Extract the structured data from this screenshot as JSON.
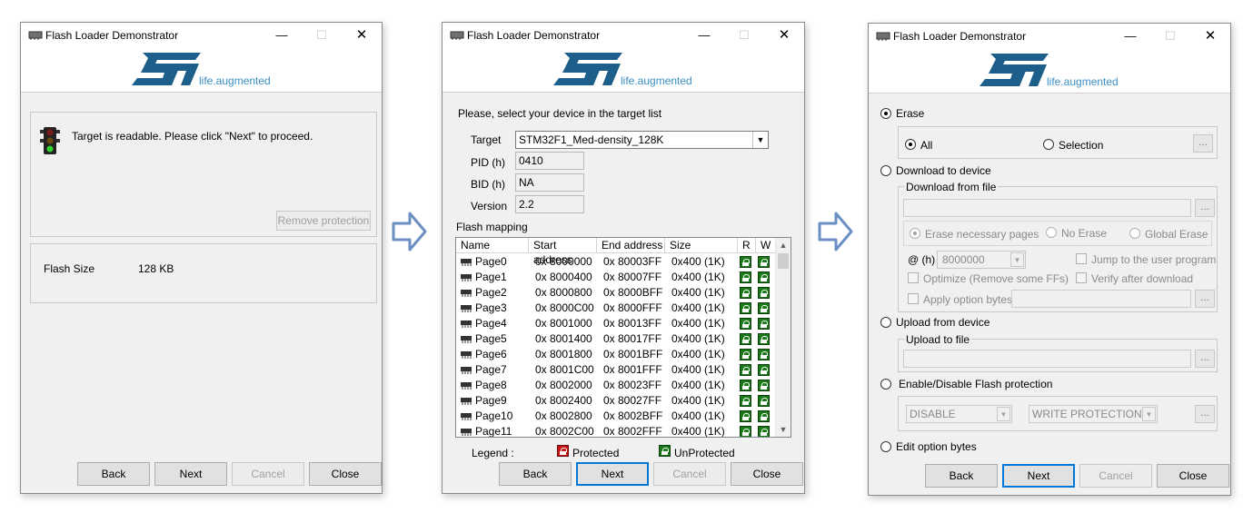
{
  "window_title": "Flash Loader Demonstrator",
  "logo": {
    "brand": "ST",
    "tagline": "life.augmented"
  },
  "buttons": {
    "back": "Back",
    "next": "Next",
    "cancel": "Cancel",
    "close": "Close"
  },
  "arrow_color": "#6b8fc2",
  "w1": {
    "message": "Target is readable. Please click \"Next\" to proceed.",
    "remove_protection": "Remove protection",
    "flash_size_label": "Flash Size",
    "flash_size_value": "128 KB"
  },
  "w2": {
    "prompt": "Please, select your device in the target list",
    "target_label": "Target",
    "target_value": "STM32F1_Med-density_128K",
    "pid_label": "PID  (h)",
    "pid_value": "0410",
    "bid_label": "BID  (h)",
    "bid_value": "NA",
    "version_label": "Version",
    "version_value": "2.2",
    "flash_mapping": "Flash mapping",
    "columns": [
      "Name",
      "Start address",
      "End address",
      "Size",
      "R",
      "W"
    ],
    "rows": [
      [
        "Page0",
        "0x 8000000",
        "0x 80003FF",
        "0x400 (1K)"
      ],
      [
        "Page1",
        "0x 8000400",
        "0x 80007FF",
        "0x400 (1K)"
      ],
      [
        "Page2",
        "0x 8000800",
        "0x 8000BFF",
        "0x400 (1K)"
      ],
      [
        "Page3",
        "0x 8000C00",
        "0x 8000FFF",
        "0x400 (1K)"
      ],
      [
        "Page4",
        "0x 8001000",
        "0x 80013FF",
        "0x400 (1K)"
      ],
      [
        "Page5",
        "0x 8001400",
        "0x 80017FF",
        "0x400 (1K)"
      ],
      [
        "Page6",
        "0x 8001800",
        "0x 8001BFF",
        "0x400 (1K)"
      ],
      [
        "Page7",
        "0x 8001C00",
        "0x 8001FFF",
        "0x400 (1K)"
      ],
      [
        "Page8",
        "0x 8002000",
        "0x 80023FF",
        "0x400 (1K)"
      ],
      [
        "Page9",
        "0x 8002400",
        "0x 80027FF",
        "0x400 (1K)"
      ],
      [
        "Page10",
        "0x 8002800",
        "0x 8002BFF",
        "0x400 (1K)"
      ],
      [
        "Page11",
        "0x 8002C00",
        "0x 8002FFF",
        "0x400 (1K)"
      ]
    ],
    "legend_label": "Legend :",
    "legend_protected": "Protected",
    "legend_unprotected": "UnProtected",
    "protected_color": "#c81414",
    "unprotected_color": "#1a7a1a"
  },
  "w3": {
    "erase": "Erase",
    "all": "All",
    "selection": "Selection",
    "download_to_device": "Download to device",
    "download_from_file": "Download from file",
    "erase_necessary": "Erase necessary pages",
    "no_erase": "No Erase",
    "global_erase": "Global Erase",
    "at_label": "@  (h)",
    "address_value": "8000000",
    "jump_to_user": "Jump to the user program",
    "optimize": "Optimize (Remove some FFs)",
    "verify": "Verify after download",
    "apply_option_bytes": "Apply option bytes",
    "upload_from_device": "Upload from device",
    "upload_to_file": "Upload to file",
    "flash_protection": "Enable/Disable Flash protection",
    "disable_value": "DISABLE",
    "write_protection_value": "WRITE PROTECTION",
    "edit_option_bytes": "Edit option bytes",
    "dots": "..."
  }
}
